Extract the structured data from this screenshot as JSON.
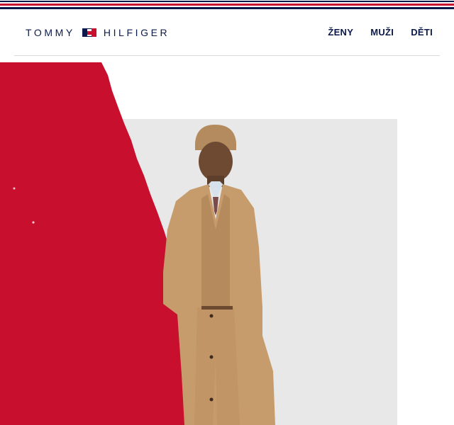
{
  "brand": {
    "name_left": "TOMMY",
    "name_right": "HILFIGER",
    "logo_icon": "flag-icon"
  },
  "nav": {
    "items": [
      {
        "label": "ŽENY"
      },
      {
        "label": "MUŽI"
      },
      {
        "label": "DĚTI"
      }
    ]
  },
  "colors": {
    "navy": "#0b1a4a",
    "red": "#c8102e",
    "photo_background": "#e8e8e8"
  }
}
